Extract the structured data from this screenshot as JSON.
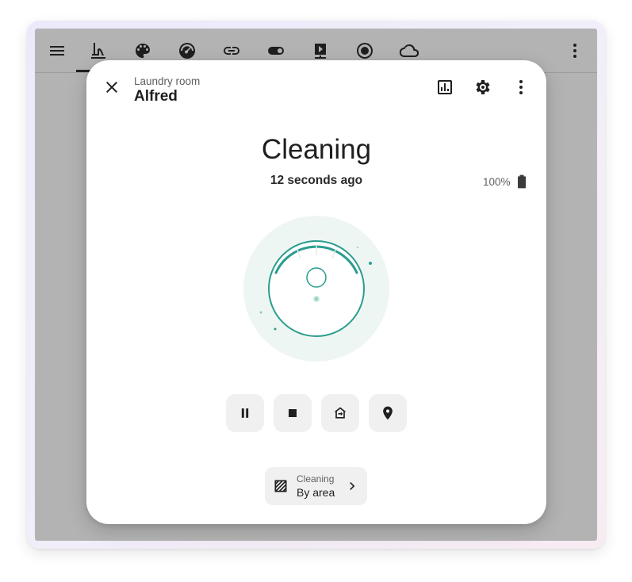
{
  "dialog": {
    "breadcrumb": "Laundry room",
    "title": "Alfred",
    "state": "Cleaning",
    "last_changed": "12 seconds ago",
    "battery": "100%",
    "mode": {
      "label": "Cleaning",
      "value": "By area"
    }
  },
  "topbar": {
    "icons": [
      "menu-icon",
      "robot-vacuum-icon",
      "palette-icon",
      "gauge-icon",
      "link-icon",
      "toggle-icon",
      "video-input-icon",
      "record-icon",
      "cloud-icon",
      "more-vert-icon"
    ]
  },
  "controls": [
    "pause-icon",
    "stop-icon",
    "return-home-icon",
    "locate-icon"
  ],
  "colors": {
    "accent": "#2a9d8f",
    "accent_light": "#eaf6f3",
    "scrim": "#b3b3b3"
  }
}
